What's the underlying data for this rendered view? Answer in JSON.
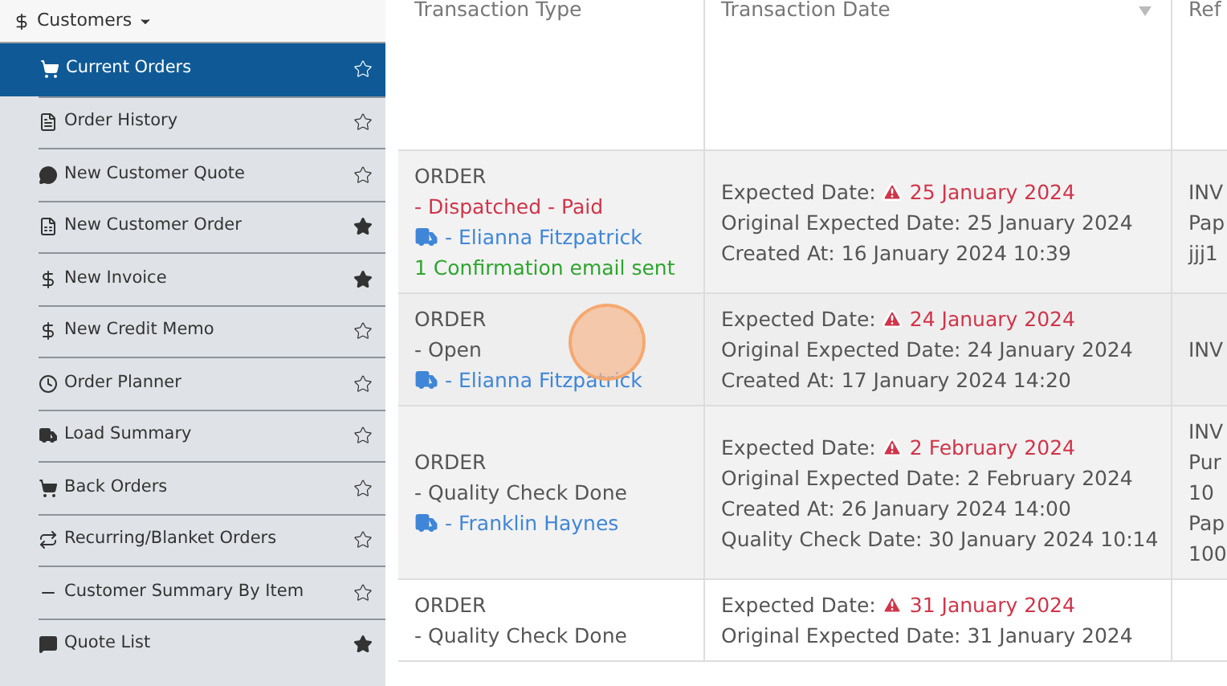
{
  "sidebar": {
    "header": {
      "label": "Customers",
      "expanded": true
    },
    "items": [
      {
        "label": "Current Orders",
        "kind": "cart",
        "selected": true,
        "favorite": false
      },
      {
        "label": "Order History",
        "kind": "file",
        "selected": false,
        "favorite": false
      },
      {
        "label": "New Customer Quote",
        "kind": "comment",
        "selected": false,
        "favorite": false
      },
      {
        "label": "New Customer Order",
        "kind": "receipt",
        "selected": false,
        "favorite": true
      },
      {
        "label": "New Invoice",
        "kind": "dollar",
        "selected": false,
        "favorite": true
      },
      {
        "label": "New Credit Memo",
        "kind": "dollar",
        "selected": false,
        "favorite": false
      },
      {
        "label": "Order Planner",
        "kind": "clock",
        "selected": false,
        "favorite": false
      },
      {
        "label": "Load Summary",
        "kind": "truck",
        "selected": false,
        "favorite": false
      },
      {
        "label": "Back Orders",
        "kind": "cart",
        "selected": false,
        "favorite": false
      },
      {
        "label": "Recurring/Blanket Orders",
        "kind": "repeat",
        "selected": false,
        "favorite": false
      },
      {
        "label": "Customer Summary By Item",
        "kind": "pallet",
        "selected": false,
        "favorite": false
      },
      {
        "label": "Quote List",
        "kind": "quote",
        "selected": false,
        "favorite": true
      }
    ]
  },
  "table": {
    "columns": [
      {
        "label": "Transaction Type",
        "sortable": false
      },
      {
        "label": "Transaction Date",
        "sortable": true
      },
      {
        "label": "Ref",
        "sortable": false
      }
    ],
    "rows": [
      {
        "type": "ORDER",
        "status": {
          "text": "- Dispatched - Paid",
          "kind": "alert"
        },
        "driver": "- Elianna Fitzpatrick",
        "note": "1 Confirmation email sent",
        "dates": [
          {
            "label": "Expected Date:",
            "value": "25 January 2024",
            "overdue": true
          },
          {
            "label": "Original Expected Date:",
            "value": "25 January 2024",
            "overdue": false
          },
          {
            "label": "Created At:",
            "value": "16 January 2024 10:39",
            "overdue": false
          }
        ],
        "ref": [
          "INV",
          "Pap",
          "jjj1"
        ]
      },
      {
        "type": "ORDER",
        "status": {
          "text": "- Open",
          "kind": "plain"
        },
        "driver": "- Elianna Fitzpatrick",
        "dates": [
          {
            "label": "Expected Date:",
            "value": "24 January 2024",
            "overdue": true
          },
          {
            "label": "Original Expected Date:",
            "value": "24 January 2024",
            "overdue": false
          },
          {
            "label": "Created At:",
            "value": "17 January 2024 14:20",
            "overdue": false
          }
        ],
        "ref": [
          "INV"
        ]
      },
      {
        "type": "ORDER",
        "status": {
          "text": "- Quality Check Done",
          "kind": "plain"
        },
        "driver": "- Franklin Haynes",
        "dates": [
          {
            "label": "Expected Date:",
            "value": "2 February 2024",
            "overdue": true
          },
          {
            "label": "Original Expected Date:",
            "value": "2 February 2024",
            "overdue": false
          },
          {
            "label": "Created At:",
            "value": "26 January 2024 14:00",
            "overdue": false
          },
          {
            "label": "Quality Check Date:",
            "value": "30 January 2024 10:14",
            "overdue": false
          }
        ],
        "ref": [
          "INV",
          "Pur",
          "10",
          "Pap",
          "100"
        ]
      },
      {
        "type": "ORDER",
        "status": {
          "text": "- Quality Check Done",
          "kind": "plain"
        },
        "dates": [
          {
            "label": "Expected Date:",
            "value": "31 January 2024",
            "overdue": true
          },
          {
            "label": "Original Expected Date:",
            "value": "31 January 2024",
            "overdue": false
          }
        ],
        "ref": []
      }
    ]
  }
}
